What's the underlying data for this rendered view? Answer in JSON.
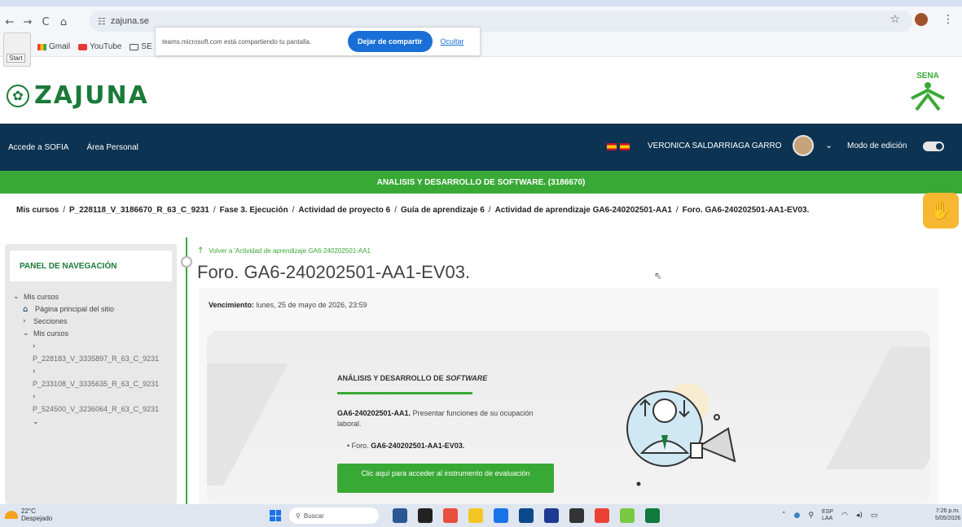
{
  "browser": {
    "url": "zajuna.se",
    "nav": {
      "back": "←",
      "forward": "→",
      "reload": "C",
      "home": "⌂"
    },
    "bookmarks": [
      {
        "label": "Gmail",
        "icon": "gmail-icon"
      },
      {
        "label": "YouTube",
        "icon": "youtube-icon"
      },
      {
        "label": "SE",
        "icon": "folder-icon"
      }
    ],
    "start_tooltip": "Start"
  },
  "share_bar": {
    "message": "teams.microsoft.com está compartiendo tu pantalla.",
    "stop_label": "Dejar de compartir",
    "hide_label": "Ocultar"
  },
  "site": {
    "logo_text": "ZAJUNA",
    "sena_text": "SENA"
  },
  "navbar": {
    "links": [
      "Accede a SOFIA",
      "Área Personal"
    ],
    "user_name": "VERONICA SALDARRIAGA GARRO",
    "edit_mode_label": "Modo de edición",
    "edit_mode_on": true
  },
  "program_title": "ANALISIS Y DESARROLLO DE SOFTWARE. (3186670)",
  "breadcrumb": [
    "Mis cursos",
    "P_228118_V_3186670_R_63_C_9231",
    "Fase 3. Ejecución",
    "Actividad de proyecto 6",
    "Guía de aprendizaje 6",
    "Actividad de aprendizaje GA6-240202501-AA1",
    "Foro. GA6-240202501-AA1-EV03."
  ],
  "sidebar": {
    "title": "PANEL DE NAVEGACIÓN",
    "my_courses": "Mis cursos",
    "home": "Página principal del sitio",
    "sections": "Secciones",
    "my_courses_sub": "Mis cursos",
    "courses": [
      "P_228183_V_3335897_R_63_C_9231",
      "P_233108_V_3335635_R_63_C_9231",
      "P_524500_V_3236064_R_63_C_9231"
    ]
  },
  "content": {
    "back_link": "Volver a 'Actividad de aprendizaje GA6-240202501-AA1",
    "title": "Foro. GA6-240202501-AA1-EV03.",
    "due_label": "Vencimiento:",
    "due_value": "lunes, 25 de mayo de 2026, 23:59",
    "card": {
      "heading": "ANÁLISIS Y DESARROLLO DE",
      "heading_italic": "SOFTWARE",
      "code": "GA6-240202501-AA1.",
      "description": "Presentar funciones de su ocupación laboral.",
      "item_prefix": "Foro.",
      "item_code": "GA6-240202501-AA1-EV03.",
      "button": "Clic aquí para acceder al instrumento de evaluación"
    }
  },
  "taskbar": {
    "temperature": "22°C",
    "weather": "Despejado",
    "search": "Buscar",
    "lang_top": "ESP",
    "lang_bottom": "LAA",
    "time": "7:26 p.m.",
    "date": "5/05/2026",
    "app_colors": [
      "#2b5797",
      "#222222",
      "#e84f3d",
      "#f3c623",
      "#1a73e8",
      "#0b4a8a",
      "#1f3a93",
      "#333333",
      "#e94235",
      "#7ac943",
      "#0f7b3f"
    ]
  },
  "colors": {
    "navy": "#0c3352",
    "green": "#39a935",
    "dark_green": "#1a7a3a",
    "accent_orange": "#f7b731"
  }
}
